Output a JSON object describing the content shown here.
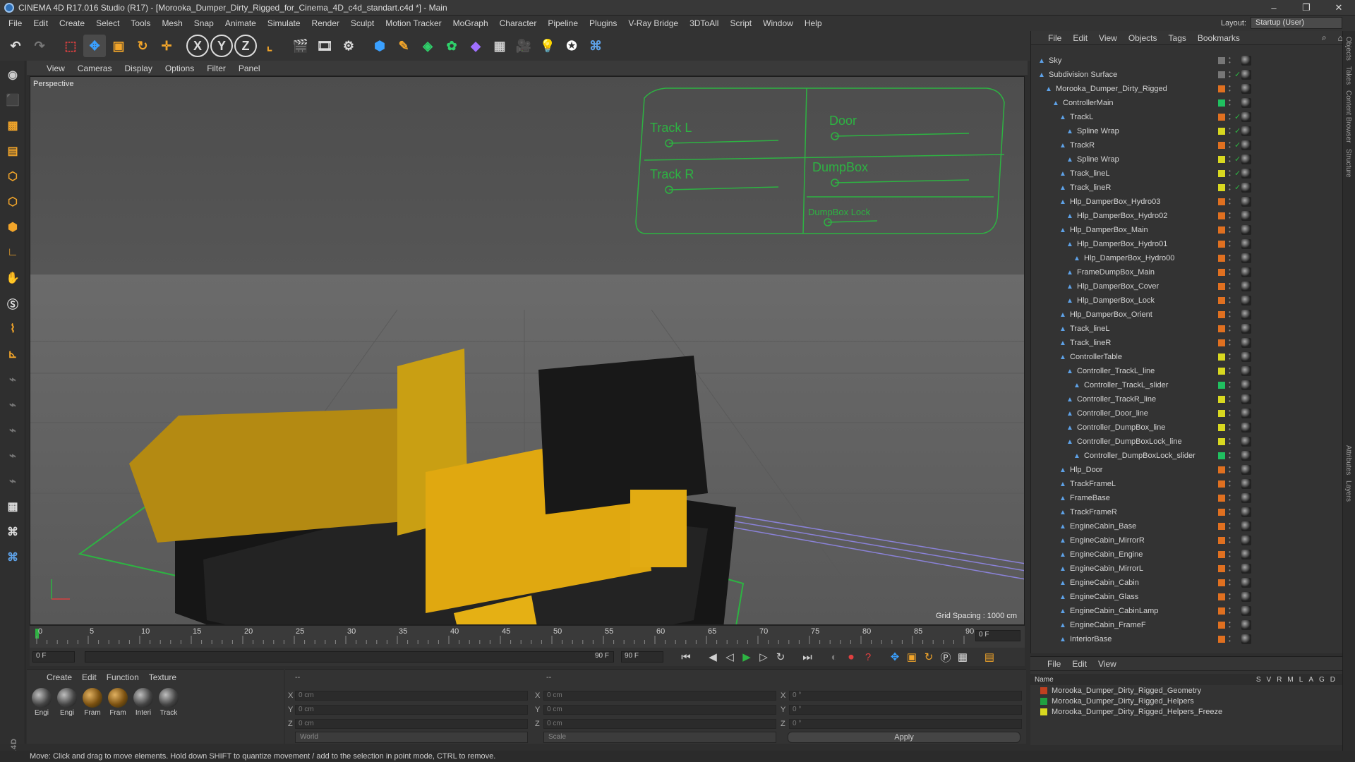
{
  "app": {
    "title": "CINEMA 4D R17.016 Studio (R17) - [Morooka_Dumper_Dirty_Rigged_for_Cinema_4D_c4d_standart.c4d *] - Main",
    "window_controls": [
      "–",
      "❐",
      "✕"
    ]
  },
  "menu": [
    "File",
    "Edit",
    "Create",
    "Select",
    "Tools",
    "Mesh",
    "Snap",
    "Animate",
    "Simulate",
    "Render",
    "Sculpt",
    "Motion Tracker",
    "MoGraph",
    "Character",
    "Pipeline",
    "Plugins",
    "V-Ray Bridge",
    "3DToAll",
    "Script",
    "Window",
    "Help"
  ],
  "layout": {
    "label": "Layout:",
    "value": "Startup (User)"
  },
  "toolbar": {
    "icons": [
      "undo-icon",
      "redo-icon",
      "select-icon",
      "move-icon",
      "scale-icon",
      "rotate-icon",
      "move-axis-icon",
      "x-axis-icon",
      "y-axis-icon",
      "z-axis-icon",
      "coordinate-icon",
      "render-view-icon",
      "render-icon",
      "render-settings-icon",
      "cube-icon",
      "pen-icon",
      "nurbs-icon",
      "array-icon",
      "deformer-icon",
      "floor-icon",
      "camera-icon",
      "light-icon",
      "sketch-icon",
      "python-icon"
    ],
    "axis_labels": [
      "X",
      "Y",
      "Z"
    ]
  },
  "viewport": {
    "menu": [
      "View",
      "Cameras",
      "Display",
      "Options",
      "Filter",
      "Panel"
    ],
    "label": "Perspective",
    "grid_spacing": "Grid Spacing : 1000 cm",
    "controllers": {
      "track_l": "Track L",
      "track_r": "Track R",
      "door": "Door",
      "dumpbox": "DumpBox",
      "dumpbox_lock": "DumpBox Lock"
    }
  },
  "timeline": {
    "ticks": [
      "0",
      "5",
      "10",
      "15",
      "20",
      "25",
      "30",
      "35",
      "40",
      "45",
      "50",
      "55",
      "60",
      "65",
      "70",
      "75",
      "80",
      "85",
      "90"
    ],
    "current": "0 F",
    "start": "0 F",
    "end": "90 F",
    "range_end": "90 F",
    "range_start": "0 F"
  },
  "materials": {
    "menu": [
      "Create",
      "Edit",
      "Function",
      "Texture"
    ],
    "items": [
      "Engi",
      "Engi",
      "Fram",
      "Fram",
      "Interi",
      "Track"
    ]
  },
  "coords": {
    "rows": [
      {
        "axis": "X",
        "pos": "0 cm",
        "size": "0 cm",
        "rot_label": "X",
        "rot": "0 °"
      },
      {
        "axis": "Y",
        "pos": "0 cm",
        "size": "0 cm",
        "rot_label": "Y",
        "rot": "0 °"
      },
      {
        "axis": "Z",
        "pos": "0 cm",
        "size": "0 cm",
        "rot_label": "Z",
        "rot": "0 °"
      }
    ],
    "size_labels": [
      "X",
      "Y",
      "Z"
    ],
    "world": "World",
    "scale": "Scale",
    "apply": "Apply",
    "dashes": [
      "--",
      "--"
    ]
  },
  "status": "Move: Click and drag to move elements. Hold down SHIFT to quantize movement / add to the selection in point mode, CTRL to remove.",
  "objects": {
    "menu": [
      "File",
      "Edit",
      "View",
      "Objects",
      "Tags",
      "Bookmarks"
    ],
    "rows": [
      {
        "name": "Sky",
        "depth": 0,
        "color": "#777777",
        "check": ""
      },
      {
        "name": "Subdivision Surface",
        "depth": 0,
        "color": "#777777",
        "check": "✓"
      },
      {
        "name": "Morooka_Dumper_Dirty_Rigged",
        "depth": 1,
        "color": "#e07020",
        "check": ""
      },
      {
        "name": "ControllerMain",
        "depth": 2,
        "color": "#20c060",
        "check": ""
      },
      {
        "name": "TrackL",
        "depth": 3,
        "color": "#e07020",
        "check": "✓"
      },
      {
        "name": "Spline Wrap",
        "depth": 4,
        "color": "#d8d820",
        "check": "✓"
      },
      {
        "name": "TrackR",
        "depth": 3,
        "color": "#e07020",
        "check": "✓"
      },
      {
        "name": "Spline Wrap",
        "depth": 4,
        "color": "#d8d820",
        "check": "✓"
      },
      {
        "name": "Track_lineL",
        "depth": 3,
        "color": "#d8d820",
        "check": "✓"
      },
      {
        "name": "Track_lineR",
        "depth": 3,
        "color": "#d8d820",
        "check": "✓"
      },
      {
        "name": "Hlp_DamperBox_Hydro03",
        "depth": 3,
        "color": "#e07020",
        "check": ""
      },
      {
        "name": "Hlp_DamperBox_Hydro02",
        "depth": 4,
        "color": "#e07020",
        "check": ""
      },
      {
        "name": "Hlp_DamperBox_Main",
        "depth": 3,
        "color": "#e07020",
        "check": ""
      },
      {
        "name": "Hlp_DamperBox_Hydro01",
        "depth": 4,
        "color": "#e07020",
        "check": ""
      },
      {
        "name": "Hlp_DamperBox_Hydro00",
        "depth": 5,
        "color": "#e07020",
        "check": ""
      },
      {
        "name": "FrameDumpBox_Main",
        "depth": 4,
        "color": "#e07020",
        "check": ""
      },
      {
        "name": "Hlp_DamperBox_Cover",
        "depth": 4,
        "color": "#e07020",
        "check": ""
      },
      {
        "name": "Hlp_DamperBox_Lock",
        "depth": 4,
        "color": "#e07020",
        "check": ""
      },
      {
        "name": "Hlp_DamperBox_Orient",
        "depth": 3,
        "color": "#e07020",
        "check": ""
      },
      {
        "name": "Track_lineL",
        "depth": 3,
        "color": "#e07020",
        "check": ""
      },
      {
        "name": "Track_lineR",
        "depth": 3,
        "color": "#e07020",
        "check": ""
      },
      {
        "name": "ControllerTable",
        "depth": 3,
        "color": "#d8d820",
        "check": ""
      },
      {
        "name": "Controller_TrackL_line",
        "depth": 4,
        "color": "#d8d820",
        "check": ""
      },
      {
        "name": "Controller_TrackL_slider",
        "depth": 5,
        "color": "#20c060",
        "check": ""
      },
      {
        "name": "Controller_TrackR_line",
        "depth": 4,
        "color": "#d8d820",
        "check": ""
      },
      {
        "name": "Controller_Door_line",
        "depth": 4,
        "color": "#d8d820",
        "check": ""
      },
      {
        "name": "Controller_DumpBox_line",
        "depth": 4,
        "color": "#d8d820",
        "check": ""
      },
      {
        "name": "Controller_DumpBoxLock_line",
        "depth": 4,
        "color": "#d8d820",
        "check": ""
      },
      {
        "name": "Controller_DumpBoxLock_slider",
        "depth": 5,
        "color": "#20c060",
        "check": ""
      },
      {
        "name": "Hlp_Door",
        "depth": 3,
        "color": "#e07020",
        "check": ""
      },
      {
        "name": "TrackFrameL",
        "depth": 3,
        "color": "#e07020",
        "check": ""
      },
      {
        "name": "FrameBase",
        "depth": 3,
        "color": "#e07020",
        "check": ""
      },
      {
        "name": "TrackFrameR",
        "depth": 3,
        "color": "#e07020",
        "check": ""
      },
      {
        "name": "EngineCabin_Base",
        "depth": 3,
        "color": "#e07020",
        "check": ""
      },
      {
        "name": "EngineCabin_MirrorR",
        "depth": 3,
        "color": "#e07020",
        "check": ""
      },
      {
        "name": "EngineCabin_Engine",
        "depth": 3,
        "color": "#e07020",
        "check": ""
      },
      {
        "name": "EngineCabin_MirrorL",
        "depth": 3,
        "color": "#e07020",
        "check": ""
      },
      {
        "name": "EngineCabin_Cabin",
        "depth": 3,
        "color": "#e07020",
        "check": ""
      },
      {
        "name": "EngineCabin_Glass",
        "depth": 3,
        "color": "#e07020",
        "check": ""
      },
      {
        "name": "EngineCabin_CabinLamp",
        "depth": 3,
        "color": "#e07020",
        "check": ""
      },
      {
        "name": "EngineCabin_FrameF",
        "depth": 3,
        "color": "#e07020",
        "check": ""
      },
      {
        "name": "InteriorBase",
        "depth": 3,
        "color": "#e07020",
        "check": ""
      }
    ]
  },
  "right_tabs": [
    "Objects",
    "Takes",
    "Content Browser",
    "Structure"
  ],
  "right_tabs_bottom": [
    "Attributes",
    "Layers"
  ],
  "layers": {
    "menu": [
      "File",
      "Edit",
      "View"
    ],
    "header": "Name",
    "cols": [
      "S",
      "V",
      "R",
      "M",
      "L",
      "A",
      "G",
      "D"
    ],
    "rows": [
      {
        "name": "Morooka_Dumper_Dirty_Rigged_Geometry",
        "color": "#c04020"
      },
      {
        "name": "Morooka_Dumper_Dirty_Rigged_Helpers",
        "color": "#20a040"
      },
      {
        "name": "Morooka_Dumper_Dirty_Rigged_Helpers_Freeze",
        "color": "#d8d820"
      }
    ]
  }
}
